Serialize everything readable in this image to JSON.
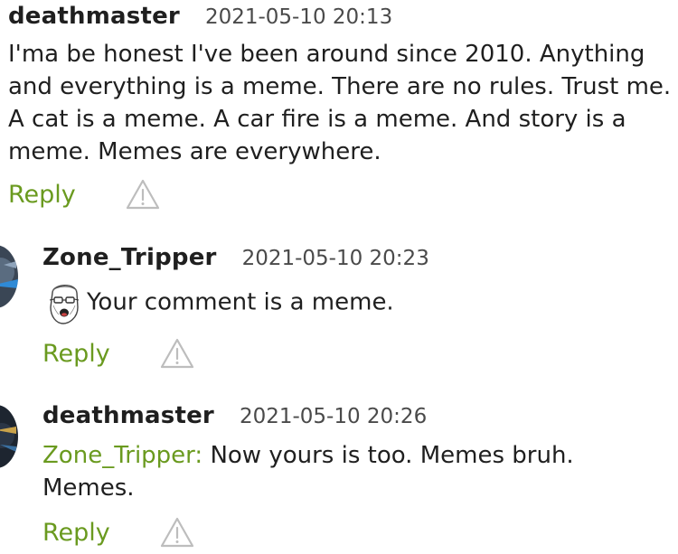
{
  "comments": [
    {
      "username": "deathmaster",
      "timestamp": "2021-05-10 20:13",
      "text": "I'ma be honest I've been around since 2010. Anything and everything is a meme. There are no rules. Trust me. A cat is a meme. A car fire is a meme. And story is a meme. Memes are everywhere.",
      "reply_label": "Reply",
      "report_icon": "warning-triangle-icon"
    },
    {
      "username": "Zone_Tripper",
      "timestamp": "2021-05-10 20:23",
      "emoji": "wojak-face-emote",
      "text": "Your comment is a meme.",
      "reply_label": "Reply",
      "report_icon": "warning-triangle-icon"
    },
    {
      "username": "deathmaster",
      "timestamp": "2021-05-10 20:26",
      "mention": "Zone_Tripper:",
      "text": "Now yours is too. Memes bruh. Memes.",
      "reply_label": "Reply",
      "report_icon": "warning-triangle-icon"
    }
  ],
  "colors": {
    "link": "#6a9a1f",
    "text": "#1f1f1f",
    "timestamp": "#4a4a4a"
  }
}
